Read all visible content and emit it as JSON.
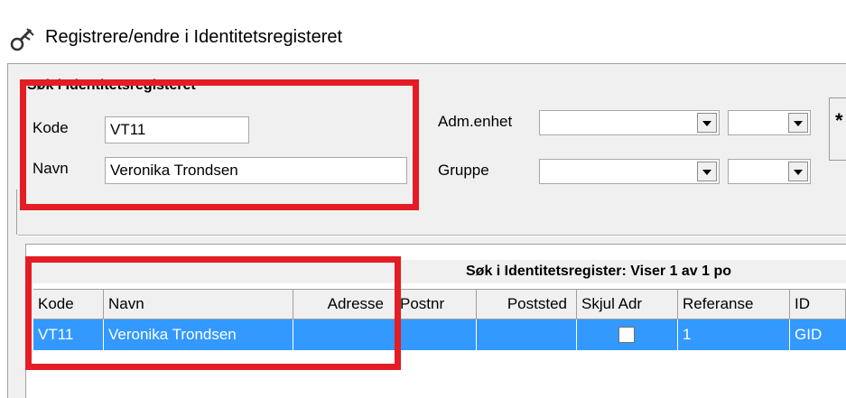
{
  "window": {
    "title": "Registrere/endre i Identitetsregisteret"
  },
  "search_group": {
    "title": "Søk i Identitetsregisteret",
    "kode_label": "Kode",
    "kode_value": "VT11",
    "navn_label": "Navn",
    "navn_value": "Veronika Trondsen",
    "adm_label": "Adm.enhet",
    "gruppe_label": "Gruppe",
    "side_button_label": "*"
  },
  "results": {
    "caption": "Søk i Identitetsregister: Viser 1 av 1 po",
    "columns": [
      "Kode",
      "Navn",
      "Adresse",
      "Postnr",
      "Poststed",
      "Skjul Adr",
      "Referanse",
      "ID"
    ],
    "rows": [
      {
        "kode": "VT11",
        "navn": "Veronika Trondsen",
        "adresse": "",
        "postnr": "",
        "poststed": "",
        "skjul_adr": false,
        "referanse": "1",
        "id": "GID"
      }
    ]
  },
  "colors": {
    "highlight": "#e41c24",
    "selection": "#3399ff"
  }
}
